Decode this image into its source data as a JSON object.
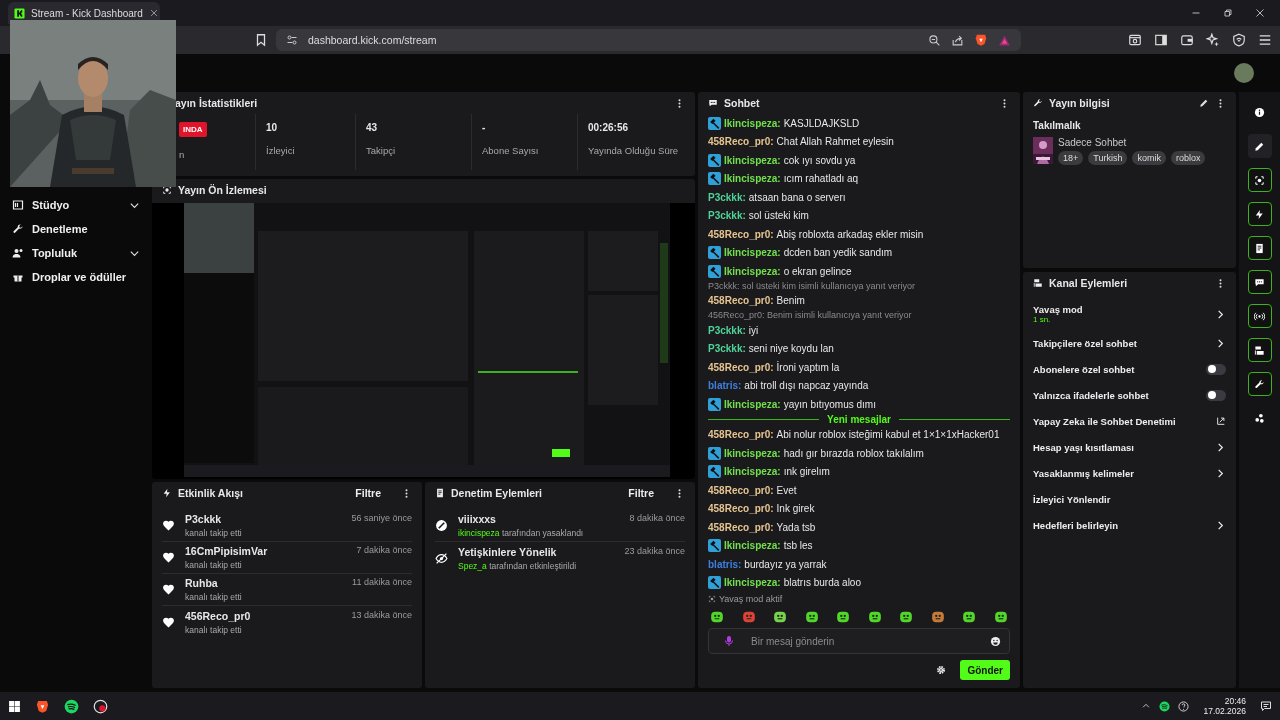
{
  "browser": {
    "tab_title": "Stream - Kick Dashboard",
    "url": "dashboard.kick.com/stream"
  },
  "sidebar": {
    "items": [
      {
        "label": "Stüdyo",
        "kind": "group"
      },
      {
        "label": "Denetleme",
        "kind": "link"
      },
      {
        "label": "Topluluk",
        "kind": "group"
      },
      {
        "label": "Droplar ve ödüller",
        "kind": "link"
      }
    ]
  },
  "stats": {
    "title": "ayın İstatistikleri",
    "live_badge": "INDA",
    "live_label": "n",
    "items": [
      {
        "value": "10",
        "label": "İzleyici"
      },
      {
        "value": "43",
        "label": "Takipçi"
      },
      {
        "value": "-",
        "label": "Abone Sayısı"
      },
      {
        "value": "00:26:56",
        "label": "Yayında Olduğu Süre"
      }
    ]
  },
  "preview": {
    "title": "Yayın Ön İzlemesi"
  },
  "activity": {
    "title": "Etkinlik Akışı",
    "filter": "Filtre",
    "items": [
      {
        "user": "P3ckkk",
        "action": "kanalı takip etti",
        "time": "56 saniye önce"
      },
      {
        "user": "16CmPipisimVar",
        "action": "kanalı takip etti",
        "time": "7 dakika önce"
      },
      {
        "user": "Ruhba",
        "action": "kanalı takip etti",
        "time": "11 dakika önce"
      },
      {
        "user": "456Reco_pr0",
        "action": "kanalı takip etti",
        "time": "13 dakika önce"
      }
    ]
  },
  "moderation": {
    "title": "Denetim Eylemleri",
    "filter": "Filtre",
    "items": [
      {
        "kind": "ban",
        "target": "viiixxxs",
        "actor": "ikincispeza",
        "action": "tarafından yasaklandı",
        "time": "8 dakika önce"
      },
      {
        "kind": "mature",
        "target": "Yetişkinlere Yönelik",
        "actor": "Spez_a",
        "action": "tarafından etkinleştirildi",
        "time": "23 dakika önce"
      }
    ]
  },
  "chat": {
    "title": "Sohbet",
    "messages": [
      {
        "kind": "message",
        "moderator": true,
        "user": "Ikincispeza:",
        "color": "#72e04c",
        "text": "KASJLDAJKSLD"
      },
      {
        "kind": "message",
        "moderator": false,
        "user": "458Reco_pr0:",
        "color": "#e6c490",
        "text": "Chat Allah Rahmet eylesin"
      },
      {
        "kind": "message",
        "moderator": true,
        "user": "Ikincispeza:",
        "color": "#72e04c",
        "text": "cok ıyı sovdu ya"
      },
      {
        "kind": "message",
        "moderator": true,
        "user": "Ikincispeza:",
        "color": "#72e04c",
        "text": "ıcım rahatladı aq"
      },
      {
        "kind": "message",
        "moderator": false,
        "user": "P3ckkk:",
        "color": "#4fd39a",
        "text": "atsaan bana o serverı"
      },
      {
        "kind": "message",
        "moderator": false,
        "user": "P3ckkk:",
        "color": "#4fd39a",
        "text": "sol üsteki kim"
      },
      {
        "kind": "message",
        "moderator": false,
        "user": "458Reco_pr0:",
        "color": "#e6c490",
        "text": "Abiş robloxta arkadaş ekler misin"
      },
      {
        "kind": "message",
        "moderator": true,
        "user": "Ikincispeza:",
        "color": "#72e04c",
        "text": "dcden ban yedik sandım"
      },
      {
        "kind": "message",
        "moderator": true,
        "user": "Ikincispeza:",
        "color": "#72e04c",
        "text": "o ekran gelince"
      },
      {
        "kind": "message",
        "moderator": false,
        "user": "458Reco_pr0:",
        "color": "#e6c490",
        "text": "Benim",
        "reply": "P3ckkk: sol üsteki kim isimli kullanıcıya yanıt veriyor"
      },
      {
        "kind": "message",
        "moderator": false,
        "user": "P3ckkk:",
        "color": "#4fd39a",
        "text": "iyi",
        "reply": "456Reco_pr0: Benim isimli kullanıcıya yanıt veriyor"
      },
      {
        "kind": "message",
        "moderator": false,
        "user": "P3ckkk:",
        "color": "#4fd39a",
        "text": "seni niye koydu lan"
      },
      {
        "kind": "message",
        "moderator": false,
        "user": "458Reco_pr0:",
        "color": "#e6c490",
        "text": "İroni yaptım la"
      },
      {
        "kind": "message",
        "moderator": false,
        "user": "blatris:",
        "color": "#3d7fe0",
        "text": "abi troll dışı napcaz yayında"
      },
      {
        "kind": "message",
        "moderator": true,
        "user": "Ikincispeza:",
        "color": "#72e04c",
        "text": "yayın bıtıyomus dımı"
      },
      {
        "kind": "divider",
        "text": "Yeni mesajlar"
      },
      {
        "kind": "message",
        "moderator": false,
        "user": "458Reco_pr0:",
        "color": "#e6c490",
        "text": "Abi nolur roblox isteğimi kabul et 1×1×1xHacker01"
      },
      {
        "kind": "message",
        "moderator": true,
        "user": "Ikincispeza:",
        "color": "#72e04c",
        "text": "hadı gır bırazda roblox takılalım"
      },
      {
        "kind": "message",
        "moderator": true,
        "user": "Ikincispeza:",
        "color": "#72e04c",
        "text": "ınk girelım"
      },
      {
        "kind": "message",
        "moderator": false,
        "user": "458Reco_pr0:",
        "color": "#e6c490",
        "text": "Evet"
      },
      {
        "kind": "message",
        "moderator": false,
        "user": "458Reco_pr0:",
        "color": "#e6c490",
        "text": "Ink girek"
      },
      {
        "kind": "message",
        "moderator": false,
        "user": "458Reco_pr0:",
        "color": "#e6c490",
        "text": "Yada tsb"
      },
      {
        "kind": "message",
        "moderator": true,
        "user": "Ikincispeza:",
        "color": "#72e04c",
        "text": "tsb les"
      },
      {
        "kind": "message",
        "moderator": false,
        "user": "blatris:",
        "color": "#3d7fe0",
        "text": "burdayız ya yarrak"
      },
      {
        "kind": "message",
        "moderator": true,
        "user": "Ikincispeza:",
        "color": "#72e04c",
        "text": "blatrıs burda aloo"
      }
    ],
    "slow_mode_notice": "Yavaş mod aktif",
    "input": {
      "placeholder": "Bir mesaj gönderin"
    },
    "send_button": "Gönder"
  },
  "stream_info": {
    "title": "Yayın bilgisi",
    "stream_title": "Takılmalık",
    "category": "Sadece Sohbet",
    "tags": [
      "18+",
      "Turkish",
      "komik",
      "roblox"
    ]
  },
  "channel_actions": {
    "title": "Kanal Eylemleri",
    "items": [
      {
        "kind": "link",
        "label": "Yavaş mod",
        "value": "1 sn."
      },
      {
        "kind": "link",
        "label": "Takipçilere özel sohbet"
      },
      {
        "kind": "toggle",
        "label": "Abonelere özel sohbet",
        "on": false
      },
      {
        "kind": "toggle",
        "label": "Yalnızca ifadelerle sohbet",
        "on": false
      },
      {
        "kind": "external",
        "label": "Yapay Zeka ile Sohbet Denetimi"
      },
      {
        "kind": "link",
        "label": "Hesap yaşı kısıtlaması"
      },
      {
        "kind": "link",
        "label": "Yasaklanmış kelimeler"
      },
      {
        "kind": "plain",
        "label": "İzleyici Yönlendir"
      },
      {
        "kind": "link",
        "label": "Hedefleri belirleyin"
      }
    ]
  },
  "rail": [
    {
      "kind": "info",
      "selected": false
    },
    {
      "kind": "pencil",
      "selected": false
    },
    {
      "kind": "camera",
      "selected": true
    },
    {
      "kind": "bolt",
      "selected": true
    },
    {
      "kind": "document",
      "selected": true
    },
    {
      "kind": "chat",
      "selected": true
    },
    {
      "kind": "broadcast",
      "selected": true
    },
    {
      "kind": "layout",
      "selected": true
    },
    {
      "kind": "wrench",
      "selected": true
    },
    {
      "kind": "dots",
      "selected": false
    }
  ],
  "taskbar": {
    "time": "20:46",
    "date": "17.02.2026"
  }
}
